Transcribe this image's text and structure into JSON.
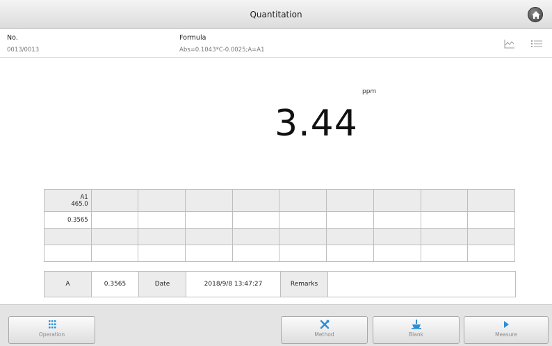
{
  "header": {
    "title": "Quantitation",
    "home_icon": "home-icon"
  },
  "info": {
    "no_label": "No.",
    "no_value": "0013/0013",
    "formula_label": "Formula",
    "formula_value": "Abs=0.1043*C-0.0025;A=A1",
    "icons": [
      "graph-icon",
      "list-icon"
    ]
  },
  "result": {
    "unit": "ppm",
    "value": "3.44"
  },
  "data_table": {
    "header_line1": "A1",
    "header_line2": "465.0",
    "value": "0.3565"
  },
  "summary": {
    "a_label": "A",
    "a_value": "0.3565",
    "date_label": "Date",
    "date_value": "2018/9/8 13:47:27",
    "remarks_label": "Remarks",
    "remarks_value": ""
  },
  "buttons": {
    "operation": "Operation",
    "method": "Method",
    "blank": "Blank",
    "measure": "Measure"
  },
  "colors": {
    "accent_blue": "#2b8fd6",
    "toolbar_gray": "#e4e4e4"
  }
}
